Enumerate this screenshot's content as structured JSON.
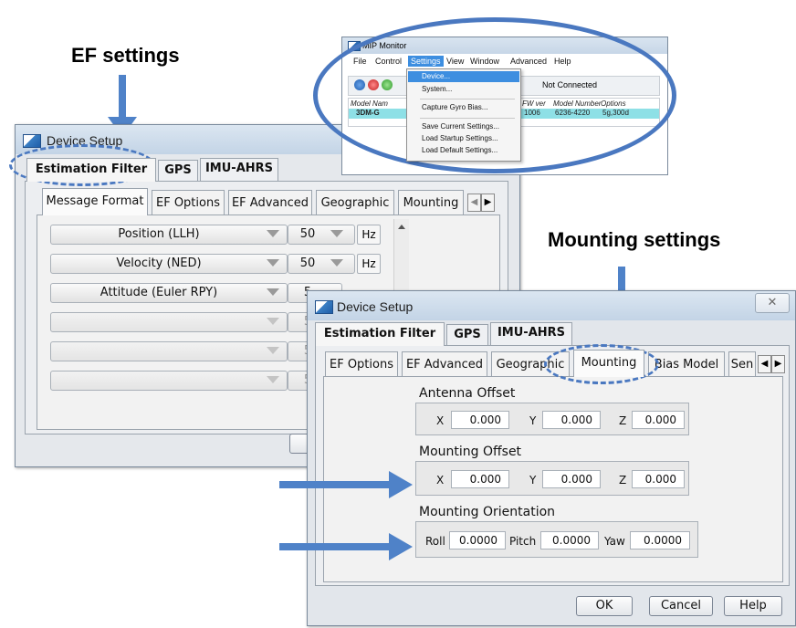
{
  "annotations": {
    "ef_settings": "EF settings",
    "mounting_settings": "Mounting settings"
  },
  "mip_monitor": {
    "title": "MIP Monitor",
    "menu": [
      "File",
      "Control",
      "Settings",
      "View",
      "Window",
      "Advanced",
      "Help"
    ],
    "settings_menu_items": [
      "Device...",
      "System...",
      "Capture Gyro Bias...",
      "Save Current Settings...",
      "Load Startup Settings...",
      "Load Default Settings..."
    ],
    "status": "Not Connected",
    "columns": [
      "Model Nam",
      "FW ver",
      "Model Number",
      "Options"
    ],
    "row": {
      "model_name": "3DM-G",
      "fw_ver": "1006",
      "model_number": "6236-4220",
      "options": "5g,300d"
    }
  },
  "ef_dialog": {
    "title": "Device Setup",
    "tabs": [
      "Estimation Filter",
      "GPS",
      "IMU-AHRS"
    ],
    "subtabs": [
      "Message Format",
      "EF Options",
      "EF Advanced",
      "Geographic",
      "Mounting"
    ],
    "rows": [
      {
        "label": "Position (LLH)",
        "rate": "50",
        "unit": "Hz"
      },
      {
        "label": "Velocity (NED)",
        "rate": "50",
        "unit": "Hz"
      },
      {
        "label": "Attitude (Euler RPY)",
        "rate": "5",
        "unit": ""
      },
      {
        "label": "",
        "rate": "5",
        "unit": ""
      },
      {
        "label": "",
        "rate": "5",
        "unit": ""
      },
      {
        "label": "",
        "rate": "5",
        "unit": ""
      }
    ]
  },
  "mount_dialog": {
    "title": "Device Setup",
    "close_glyph": "✕",
    "tabs": [
      "Estimation Filter",
      "GPS",
      "IMU-AHRS"
    ],
    "subtabs": [
      "EF Options",
      "EF Advanced",
      "Geographic",
      "Mounting",
      "Bias Model",
      "Sen"
    ],
    "antenna_offset": {
      "title": "Antenna Offset",
      "labels": [
        "X",
        "Y",
        "Z"
      ],
      "values": [
        "0.000",
        "0.000",
        "0.000"
      ]
    },
    "mounting_offset": {
      "title": "Mounting Offset",
      "labels": [
        "X",
        "Y",
        "Z"
      ],
      "values": [
        "0.000",
        "0.000",
        "0.000"
      ]
    },
    "mounting_orientation": {
      "title": "Mounting Orientation",
      "labels": [
        "Roll",
        "Pitch",
        "Yaw"
      ],
      "values": [
        "0.0000",
        "0.0000",
        "0.0000"
      ]
    },
    "buttons": {
      "ok": "OK",
      "cancel": "Cancel",
      "help": "Help"
    }
  },
  "colors": {
    "accent_arrow": "#4f82c8",
    "highlight_row": "#8ee0e6",
    "menu_highlight": "#3d8ee0"
  }
}
